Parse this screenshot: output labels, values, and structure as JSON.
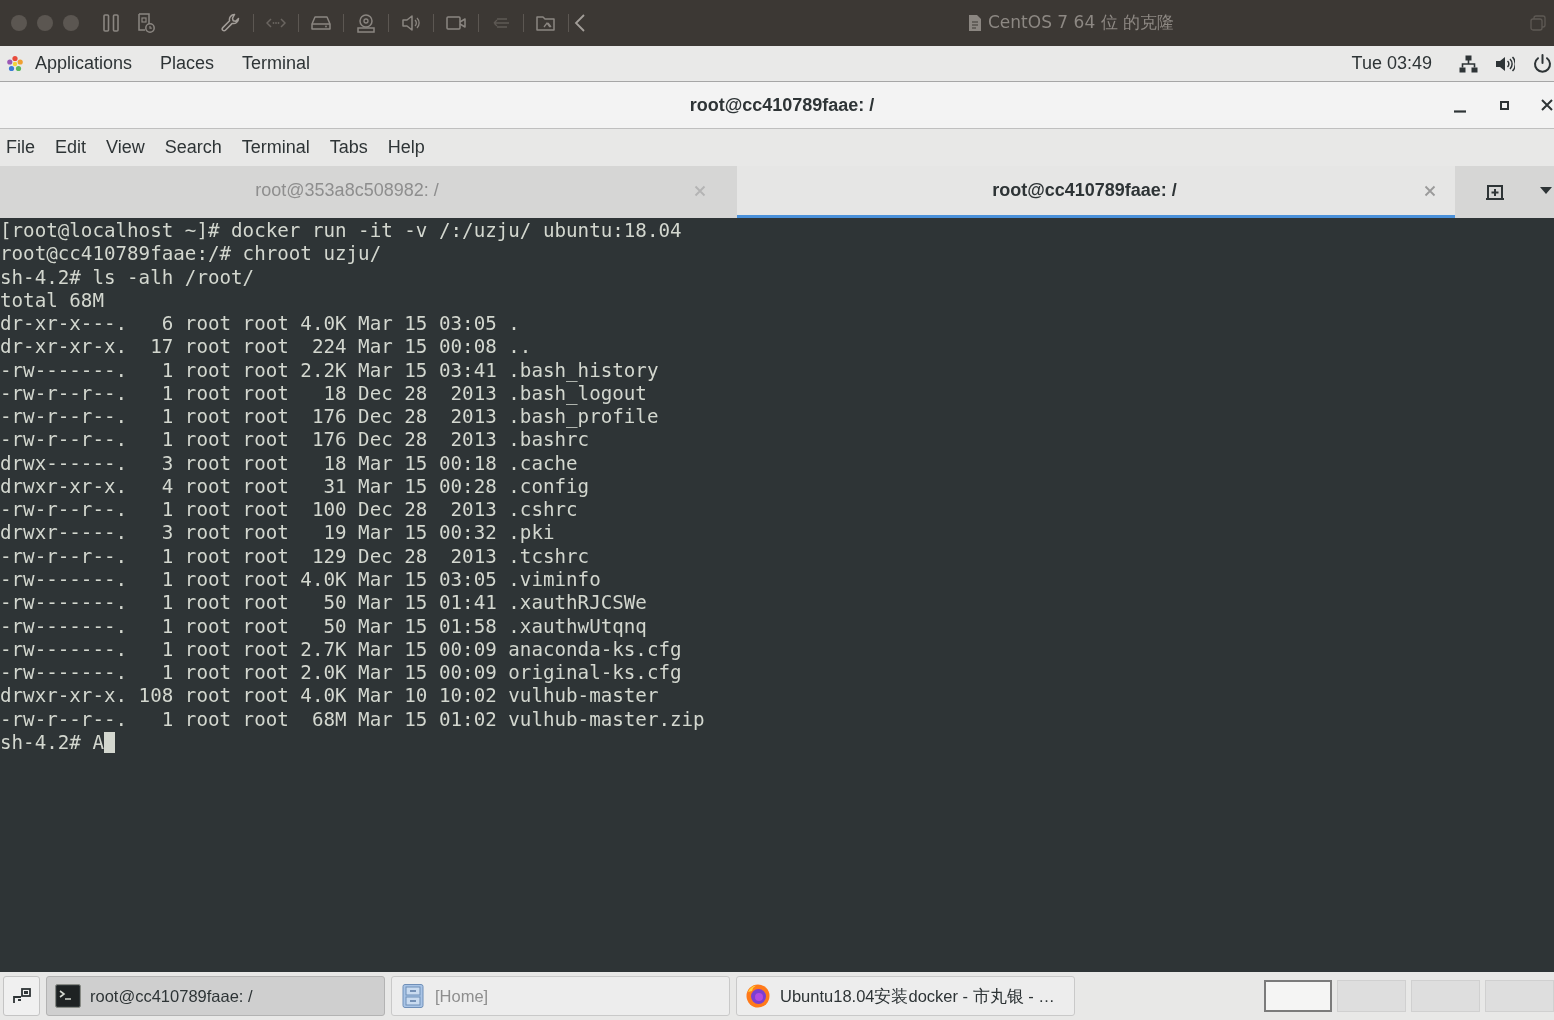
{
  "vm_toolbar": {
    "title": "CentOS 7 64 位 的克隆"
  },
  "top_bar": {
    "menus": [
      "Applications",
      "Places",
      "Terminal"
    ],
    "clock": "Tue 03:49"
  },
  "window": {
    "title": "root@cc410789faae: /"
  },
  "menu_bar": [
    "File",
    "Edit",
    "View",
    "Search",
    "Terminal",
    "Tabs",
    "Help"
  ],
  "tabs": [
    {
      "label": "root@353a8c508982: /",
      "selected": false
    },
    {
      "label": "root@cc410789faae: /",
      "selected": true
    }
  ],
  "terminal": {
    "lines": [
      "[root@localhost ~]# docker run -it -v /:/uzju/ ubuntu:18.04",
      "root@cc410789faae:/# chroot uzju/",
      "sh-4.2# ls -alh /root/",
      "total 68M",
      "dr-xr-x---.   6 root root 4.0K Mar 15 03:05 .",
      "dr-xr-xr-x.  17 root root  224 Mar 15 00:08 ..",
      "-rw-------.   1 root root 2.2K Mar 15 03:41 .bash_history",
      "-rw-r--r--.   1 root root   18 Dec 28  2013 .bash_logout",
      "-rw-r--r--.   1 root root  176 Dec 28  2013 .bash_profile",
      "-rw-r--r--.   1 root root  176 Dec 28  2013 .bashrc",
      "drwx------.   3 root root   18 Mar 15 00:18 .cache",
      "drwxr-xr-x.   4 root root   31 Mar 15 00:28 .config",
      "-rw-r--r--.   1 root root  100 Dec 28  2013 .cshrc",
      "drwxr-----.   3 root root   19 Mar 15 00:32 .pki",
      "-rw-r--r--.   1 root root  129 Dec 28  2013 .tcshrc",
      "-rw-------.   1 root root 4.0K Mar 15 03:05 .viminfo",
      "-rw-------.   1 root root   50 Mar 15 01:41 .xauthRJCSWe",
      "-rw-------.   1 root root   50 Mar 15 01:58 .xauthwUtqnq",
      "-rw-------.   1 root root 2.7K Mar 15 00:09 anaconda-ks.cfg",
      "-rw-------.   1 root root 2.0K Mar 15 00:09 original-ks.cfg",
      "drwxr-xr-x. 108 root root 4.0K Mar 10 10:02 vulhub-master",
      "-rw-r--r--.   1 root root  68M Mar 15 01:02 vulhub-master.zip",
      "sh-4.2# A"
    ]
  },
  "taskbar": {
    "windows": [
      {
        "kind": "terminal",
        "label": "root@cc410789faae: /",
        "selected": true,
        "minimized": false
      },
      {
        "kind": "files",
        "label": "[Home]",
        "selected": false,
        "minimized": true
      },
      {
        "kind": "browser",
        "label": "Ubuntu18.04安装docker - 市丸银 - …",
        "selected": false,
        "minimized": false
      }
    ],
    "workspaces": [
      {
        "selected": true
      },
      {
        "selected": false
      },
      {
        "selected": false
      },
      {
        "selected": false
      }
    ]
  }
}
